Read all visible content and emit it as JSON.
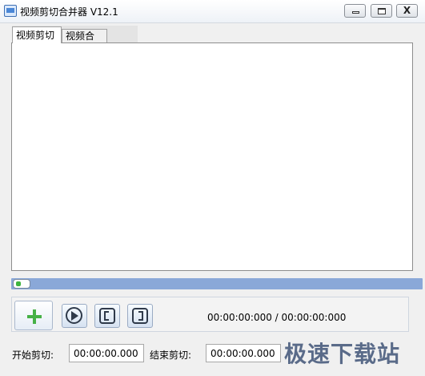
{
  "window": {
    "title": "视频剪切合并器 V12.1",
    "close_symbol": "X"
  },
  "tabs": [
    {
      "label": "视频剪切",
      "active": true
    },
    {
      "label": "视频合并",
      "active": false
    }
  ],
  "progress": {
    "value": 0
  },
  "controls": {
    "timecode": "00:00:00:000 / 00:00:00:000"
  },
  "cut": {
    "start_label": "开始剪切:",
    "start_value": "00:00:00.000",
    "end_label": "结束剪切:",
    "end_value": "00:00:00.000"
  },
  "icons": {
    "add": "plus-icon",
    "play": "play-icon",
    "mark_in": "mark-in-icon",
    "mark_out": "mark-out-icon"
  },
  "colors": {
    "progress_track": "#8aa8d8",
    "add_icon": "#46b146"
  },
  "watermark": "极速下载站"
}
